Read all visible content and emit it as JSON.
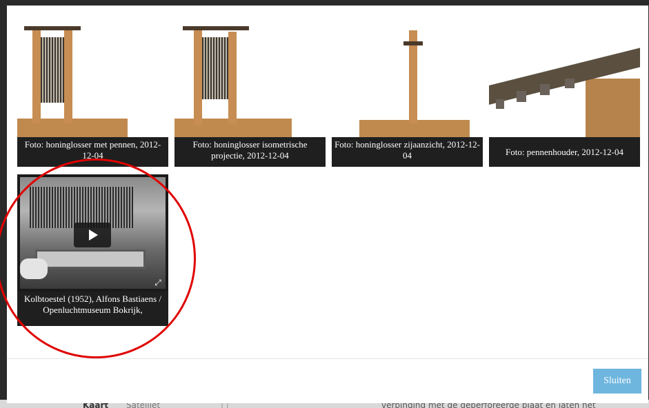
{
  "backdrop": {
    "map_tab_kaart": "Kaart",
    "map_tab_satelliet": "Satelliet",
    "body_text": "verbinding met de geperforeerde plaat en laten het"
  },
  "gallery": {
    "items": [
      {
        "type": "photo",
        "caption": "Foto: honinglosser met pennen, 2012-12-04"
      },
      {
        "type": "photo",
        "caption": "Foto: honinglosser isometrische projectie, 2012-12-04"
      },
      {
        "type": "photo",
        "caption": "Foto: honinglosser zijaanzicht, 2012-12-04"
      },
      {
        "type": "photo",
        "caption": "Foto: pennenhouder, 2012-12-04"
      },
      {
        "type": "video",
        "caption": "Kolbtoestel (1952), Alfons Bastiaens / Openluchtmuseum Bokrijk,"
      }
    ]
  },
  "footer": {
    "close_label": "Sluiten"
  },
  "colors": {
    "close_button": "#6fb6df",
    "caption_bg": "#1f1f1f",
    "annotation": "#e00000"
  }
}
